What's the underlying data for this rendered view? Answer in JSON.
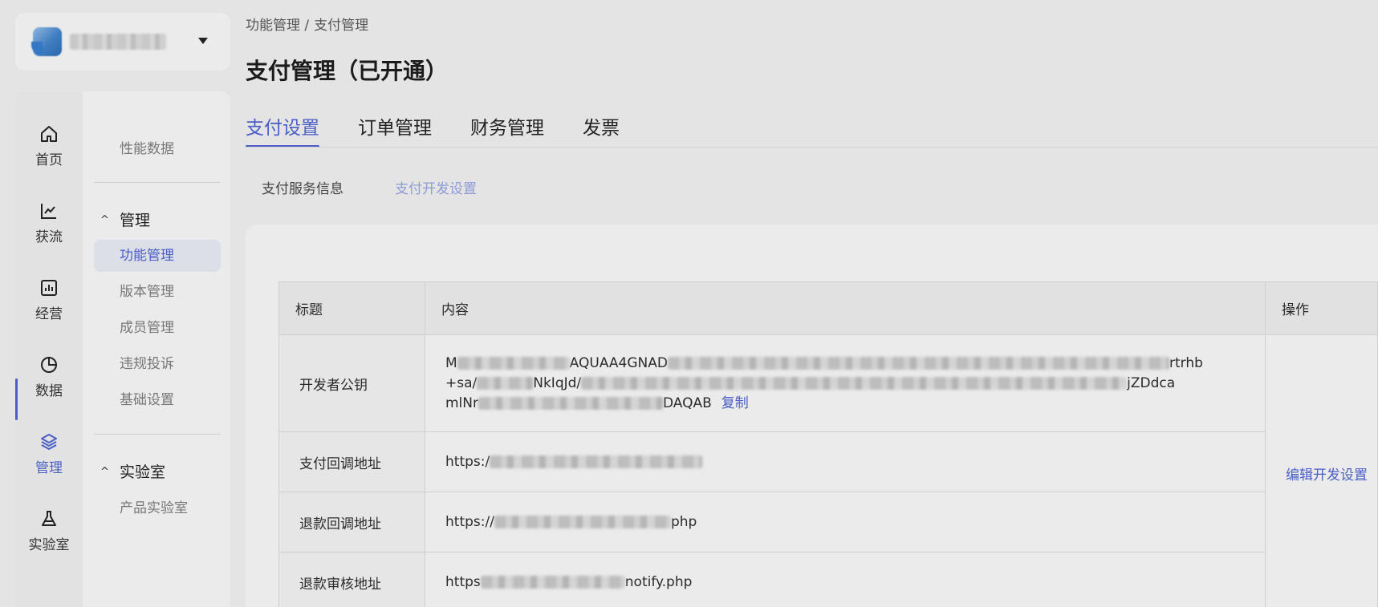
{
  "breadcrumb": {
    "part1": "功能管理 /",
    "part2": "支付管理"
  },
  "page_title": "支付管理（已开通）",
  "tabs": [
    {
      "label": "支付设置",
      "active": true
    },
    {
      "label": "订单管理"
    },
    {
      "label": "财务管理"
    },
    {
      "label": "发票"
    }
  ],
  "subtabs": [
    {
      "label": "支付服务信息"
    },
    {
      "label": "支付开发设置",
      "active": true
    }
  ],
  "rail": [
    {
      "label": "首页",
      "icon": "home-icon"
    },
    {
      "label": "获流",
      "icon": "trend-chart-icon"
    },
    {
      "label": "经营",
      "icon": "bar-chart-icon"
    },
    {
      "label": "数据",
      "icon": "pie-chart-icon"
    },
    {
      "label": "管理",
      "icon": "layers-icon",
      "active": true
    },
    {
      "label": "实验室",
      "icon": "flask-icon"
    }
  ],
  "subnav": {
    "perf": "性能数据",
    "group_manage": "管理",
    "manage_items": [
      "功能管理",
      "版本管理",
      "成员管理",
      "违规投诉",
      "基础设置"
    ],
    "group_lab": "实验室",
    "lab_items": [
      "产品实验室"
    ]
  },
  "table": {
    "headers": {
      "title": "标题",
      "content": "内容",
      "op": "操作"
    },
    "rows": [
      {
        "title": "开发者公钥",
        "line1_start": "M",
        "line1_mid": "AQUAA4GNAD",
        "line1_end": "rtrhb",
        "line2_start": "+sa/",
        "line2_mid": "NkIqJd/",
        "line2_end": "jZDdca",
        "line3_start": "mlNr",
        "line3_end": "DAQAB",
        "copy_label": "复制"
      },
      {
        "title": "支付回调地址",
        "prefix": "https:/",
        "suffix": ""
      },
      {
        "title": "退款回调地址",
        "prefix": "https://",
        "suffix": "php"
      },
      {
        "title": "退款审核地址",
        "prefix": "https",
        "suffix": "notify.php"
      }
    ],
    "edit_label": "编辑开发设置"
  },
  "colors": {
    "accent": "#4a5ec4",
    "accent_light": "#8e9bd6",
    "background": "#e4e4e4"
  }
}
